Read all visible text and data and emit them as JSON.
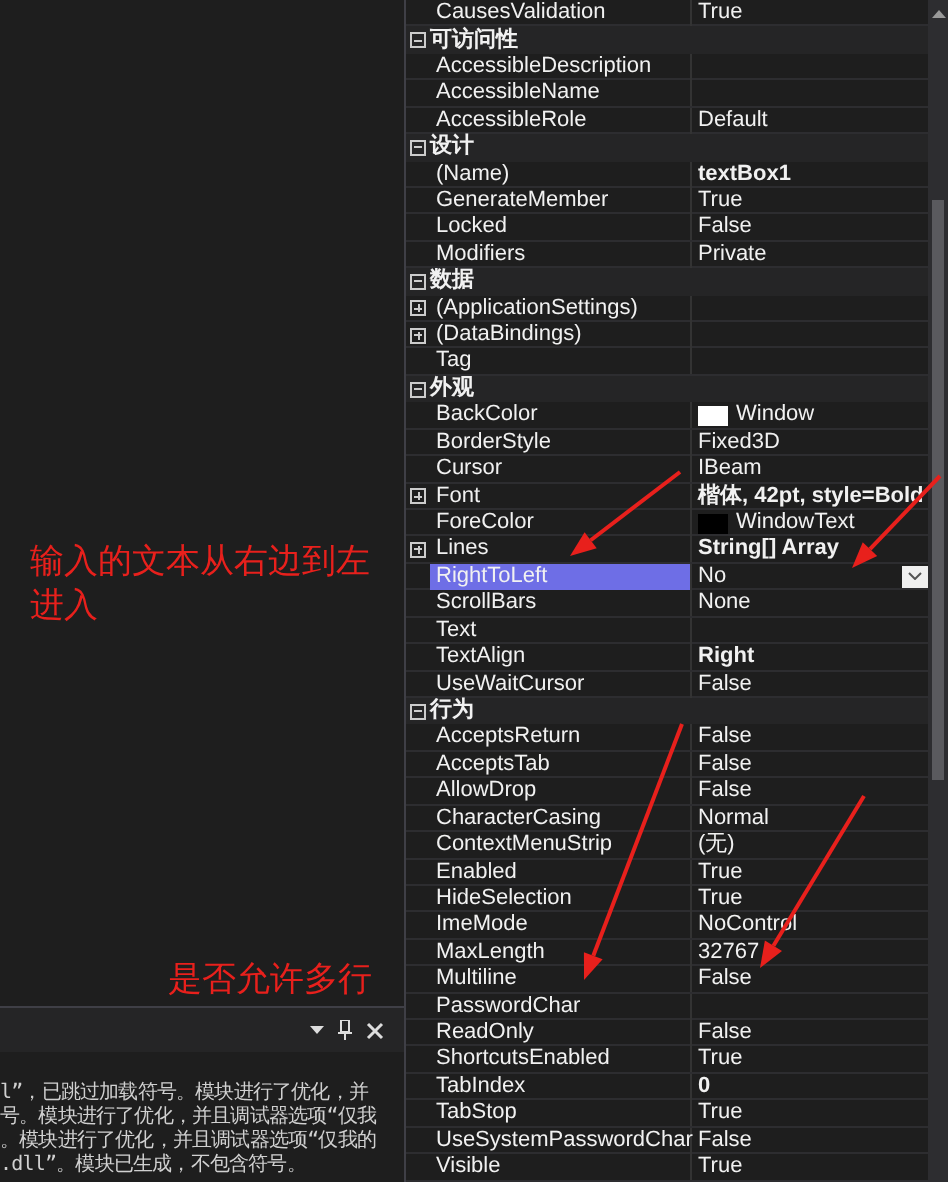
{
  "editor": {
    "annotations": [
      "输入的文本从右边到左进入",
      "是否允许多行"
    ]
  },
  "output": {
    "lines": [
      "l”，已跳过加载符号。模块进行了优化，并",
      "号。模块进行了优化，并且调试器选项“仅我",
      "。模块进行了优化，并且调试器选项“仅我的",
      ".dll”。模块已生成，不包含符号。"
    ]
  },
  "properties": {
    "categories": [
      {
        "rows": [
          {
            "name": "CausesValidation",
            "value": "True",
            "bold": false,
            "expandable": false,
            "selected": false
          }
        ]
      },
      {
        "title": "可访问性",
        "expanded": true,
        "rows": [
          {
            "name": "AccessibleDescription",
            "expandable": false,
            "selected": false
          },
          {
            "name": "AccessibleName",
            "expandable": false,
            "selected": false
          },
          {
            "name": "AccessibleRole",
            "value": "Default",
            "bold": false,
            "expandable": false,
            "selected": false
          }
        ]
      },
      {
        "title": "设计",
        "expanded": true,
        "rows": [
          {
            "name": "(Name)",
            "value": "textBox1",
            "bold": true,
            "expandable": false,
            "selected": false
          },
          {
            "name": "GenerateMember",
            "value": "True",
            "bold": false,
            "expandable": false,
            "selected": false
          },
          {
            "name": "Locked",
            "value": "False",
            "bold": false,
            "expandable": false,
            "selected": false
          },
          {
            "name": "Modifiers",
            "value": "Private",
            "bold": false,
            "expandable": false,
            "selected": false
          }
        ]
      },
      {
        "title": "数据",
        "expanded": true,
        "rows": [
          {
            "name": "(ApplicationSettings)",
            "expandable": true,
            "selected": false
          },
          {
            "name": "(DataBindings)",
            "expandable": true,
            "selected": false
          },
          {
            "name": "Tag",
            "expandable": false,
            "selected": false
          }
        ]
      },
      {
        "title": "外观",
        "expanded": true,
        "rows": [
          {
            "name": "BackColor",
            "value": "Window",
            "color": "#ffffff",
            "bold": false,
            "expandable": false,
            "selected": false
          },
          {
            "name": "BorderStyle",
            "value": "Fixed3D",
            "bold": false,
            "expandable": false,
            "selected": false
          },
          {
            "name": "Cursor",
            "value": "IBeam",
            "bold": false,
            "expandable": false,
            "selected": false
          },
          {
            "name": "Font",
            "value": "楷体, 42pt, style=Bold",
            "bold": true,
            "expandable": true,
            "selected": false
          },
          {
            "name": "ForeColor",
            "value": "WindowText",
            "color": "#000000",
            "bold": false,
            "expandable": false,
            "selected": false
          },
          {
            "name": "Lines",
            "value": "String[] Array",
            "bold": true,
            "expandable": true,
            "selected": false
          },
          {
            "name": "RightToLeft",
            "value": "No",
            "bold": false,
            "expandable": false,
            "selected": true
          },
          {
            "name": "ScrollBars",
            "value": "None",
            "bold": false,
            "expandable": false,
            "selected": false
          },
          {
            "name": "Text",
            "expandable": false,
            "selected": false
          },
          {
            "name": "TextAlign",
            "value": "Right",
            "bold": true,
            "expandable": false,
            "selected": false
          },
          {
            "name": "UseWaitCursor",
            "value": "False",
            "bold": false,
            "expandable": false,
            "selected": false
          }
        ]
      },
      {
        "title": "行为",
        "expanded": true,
        "rows": [
          {
            "name": "AcceptsReturn",
            "value": "False",
            "bold": false,
            "expandable": false,
            "selected": false
          },
          {
            "name": "AcceptsTab",
            "value": "False",
            "bold": false,
            "expandable": false,
            "selected": false
          },
          {
            "name": "AllowDrop",
            "value": "False",
            "bold": false,
            "expandable": false,
            "selected": false
          },
          {
            "name": "CharacterCasing",
            "value": "Normal",
            "bold": false,
            "expandable": false,
            "selected": false
          },
          {
            "name": "ContextMenuStrip",
            "value": "(无)",
            "bold": false,
            "expandable": false,
            "selected": false
          },
          {
            "name": "Enabled",
            "value": "True",
            "bold": false,
            "expandable": false,
            "selected": false
          },
          {
            "name": "HideSelection",
            "value": "True",
            "bold": false,
            "expandable": false,
            "selected": false
          },
          {
            "name": "ImeMode",
            "value": "NoControl",
            "bold": false,
            "expandable": false,
            "selected": false
          },
          {
            "name": "MaxLength",
            "value": "32767",
            "bold": false,
            "expandable": false,
            "selected": false
          },
          {
            "name": "Multiline",
            "value": "False",
            "bold": false,
            "expandable": false,
            "selected": false
          },
          {
            "name": "PasswordChar",
            "expandable": false,
            "selected": false
          },
          {
            "name": "ReadOnly",
            "value": "False",
            "bold": false,
            "expandable": false,
            "selected": false
          },
          {
            "name": "ShortcutsEnabled",
            "value": "True",
            "bold": false,
            "expandable": false,
            "selected": false
          },
          {
            "name": "TabIndex",
            "value": "0",
            "bold": true,
            "expandable": false,
            "selected": false
          },
          {
            "name": "TabStop",
            "value": "True",
            "bold": false,
            "expandable": false,
            "selected": false
          },
          {
            "name": "UseSystemPasswordChar",
            "value": "False",
            "bold": false,
            "expandable": false,
            "selected": false
          },
          {
            "name": "Visible",
            "value": "True",
            "bold": false,
            "expandable": false,
            "selected": false
          }
        ]
      }
    ]
  }
}
